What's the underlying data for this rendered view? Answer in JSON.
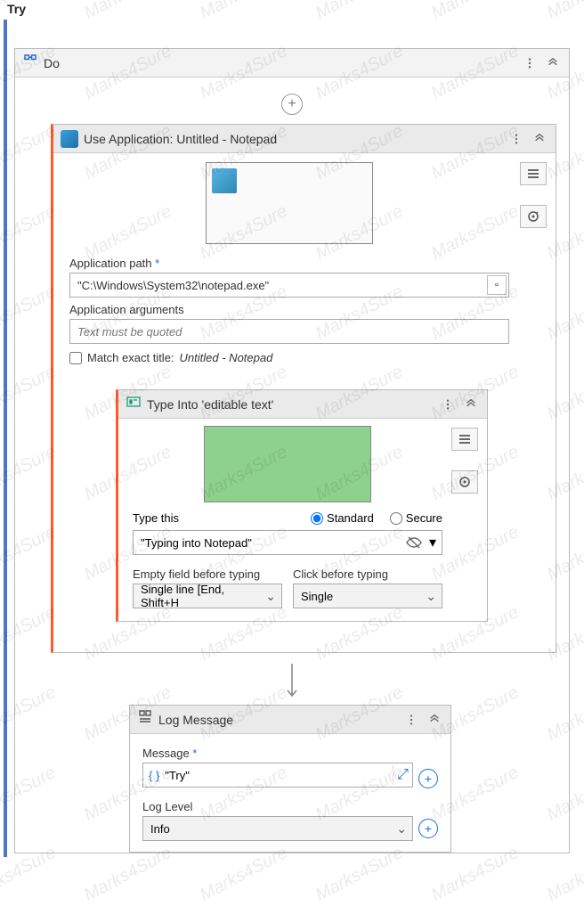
{
  "try_label": "Try",
  "do_block": {
    "title": "Do"
  },
  "use_app": {
    "title": "Use Application: Untitled - Notepad",
    "app_path_label": "Application path",
    "app_path_value": "\"C:\\Windows\\System32\\notepad.exe\"",
    "app_args_label": "Application arguments",
    "app_args_placeholder": "Text must be quoted",
    "match_title_label": "Match exact title:",
    "match_title_value": "Untitled - Notepad"
  },
  "type_into": {
    "title": "Type Into 'editable text'",
    "type_this_label": "Type this",
    "radio_standard": "Standard",
    "radio_secure": "Secure",
    "type_value": "\"Typing into Notepad\"",
    "empty_label": "Empty field before typing",
    "empty_value": "Single line [End, Shift+H",
    "click_label": "Click before typing",
    "click_value": "Single"
  },
  "log_msg": {
    "title": "Log Message",
    "message_label": "Message",
    "message_value": "\"Try\"",
    "loglevel_label": "Log Level",
    "loglevel_value": "Info"
  },
  "watermark_text": "Marks4Sure"
}
